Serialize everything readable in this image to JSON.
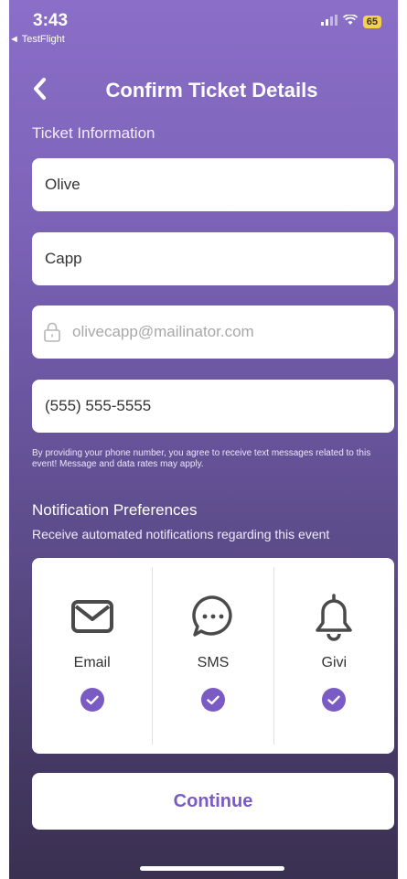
{
  "status_bar": {
    "time": "3:43",
    "back_app": "◄ TestFlight",
    "battery": "65"
  },
  "header": {
    "title": "Confirm Ticket Details"
  },
  "ticket_info": {
    "section_label": "Ticket Information",
    "first_name": "Olive",
    "last_name": "Capp",
    "email": "olivecapp@mailinator.com",
    "phone": "(555) 555-5555",
    "disclaimer": "By providing your phone number, you agree to receive text messages related to this event! Message and data rates may apply."
  },
  "notifications": {
    "title": "Notification Preferences",
    "subtitle": "Receive automated notifications regarding this event",
    "options": [
      {
        "label": "Email",
        "icon": "envelope-icon",
        "checked": true
      },
      {
        "label": "SMS",
        "icon": "chat-bubble-icon",
        "checked": true
      },
      {
        "label": "Givi",
        "icon": "bell-icon",
        "checked": true
      }
    ]
  },
  "actions": {
    "continue_label": "Continue"
  },
  "colors": {
    "accent": "#7a5bc4",
    "gradient_top": "#8a6ec8",
    "gradient_bottom": "#3a3050"
  }
}
